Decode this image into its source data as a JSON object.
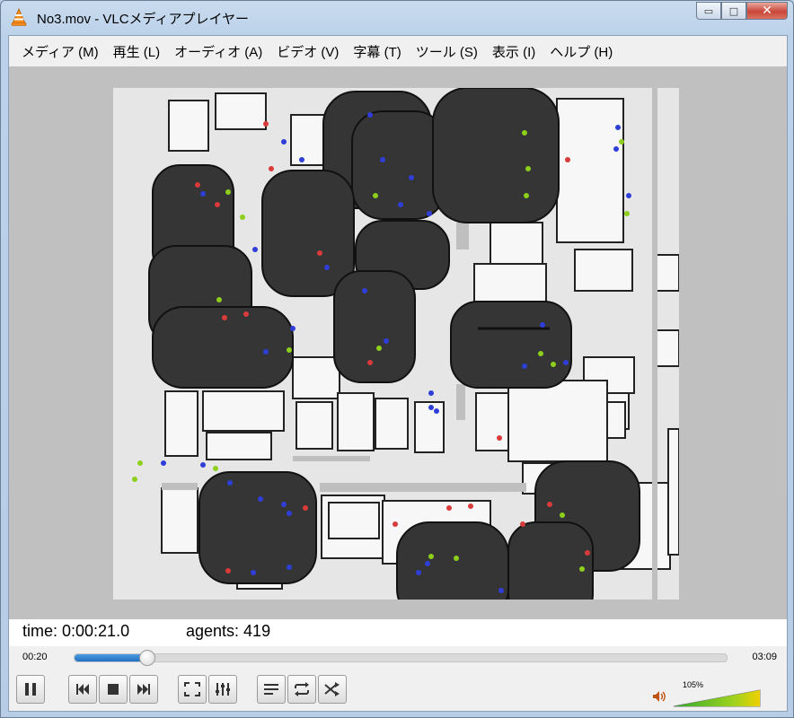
{
  "window": {
    "title": "No3.mov - VLCメディアプレイヤー",
    "minimize": "▭",
    "maximize": "□",
    "close": "✕"
  },
  "menu": [
    "メディア (M)",
    "再生 (L)",
    "オーディオ (A)",
    "ビデオ (V)",
    "字幕 (T)",
    "ツール (S)",
    "表示 (I)",
    "ヘルプ (H)"
  ],
  "overlay": {
    "time_label": "time: 0:00:21.0",
    "agents_label": "agents: 419"
  },
  "seek": {
    "elapsed": "00:20",
    "total": "03:09",
    "progress_fraction": 0.11
  },
  "volume": {
    "label": "105%",
    "level_fraction": 1.05
  },
  "controls": {
    "buttons": [
      "pause",
      "previous",
      "stop",
      "next",
      "fullscreen",
      "extended-settings",
      "playlist",
      "loop",
      "shuffle"
    ]
  },
  "colors": {
    "seek_fill": "#2b7bd0",
    "agent_red": "#d93a3a",
    "agent_blue": "#2d3fd6",
    "agent_green": "#8ecf1d",
    "building_dark": "#353535"
  }
}
